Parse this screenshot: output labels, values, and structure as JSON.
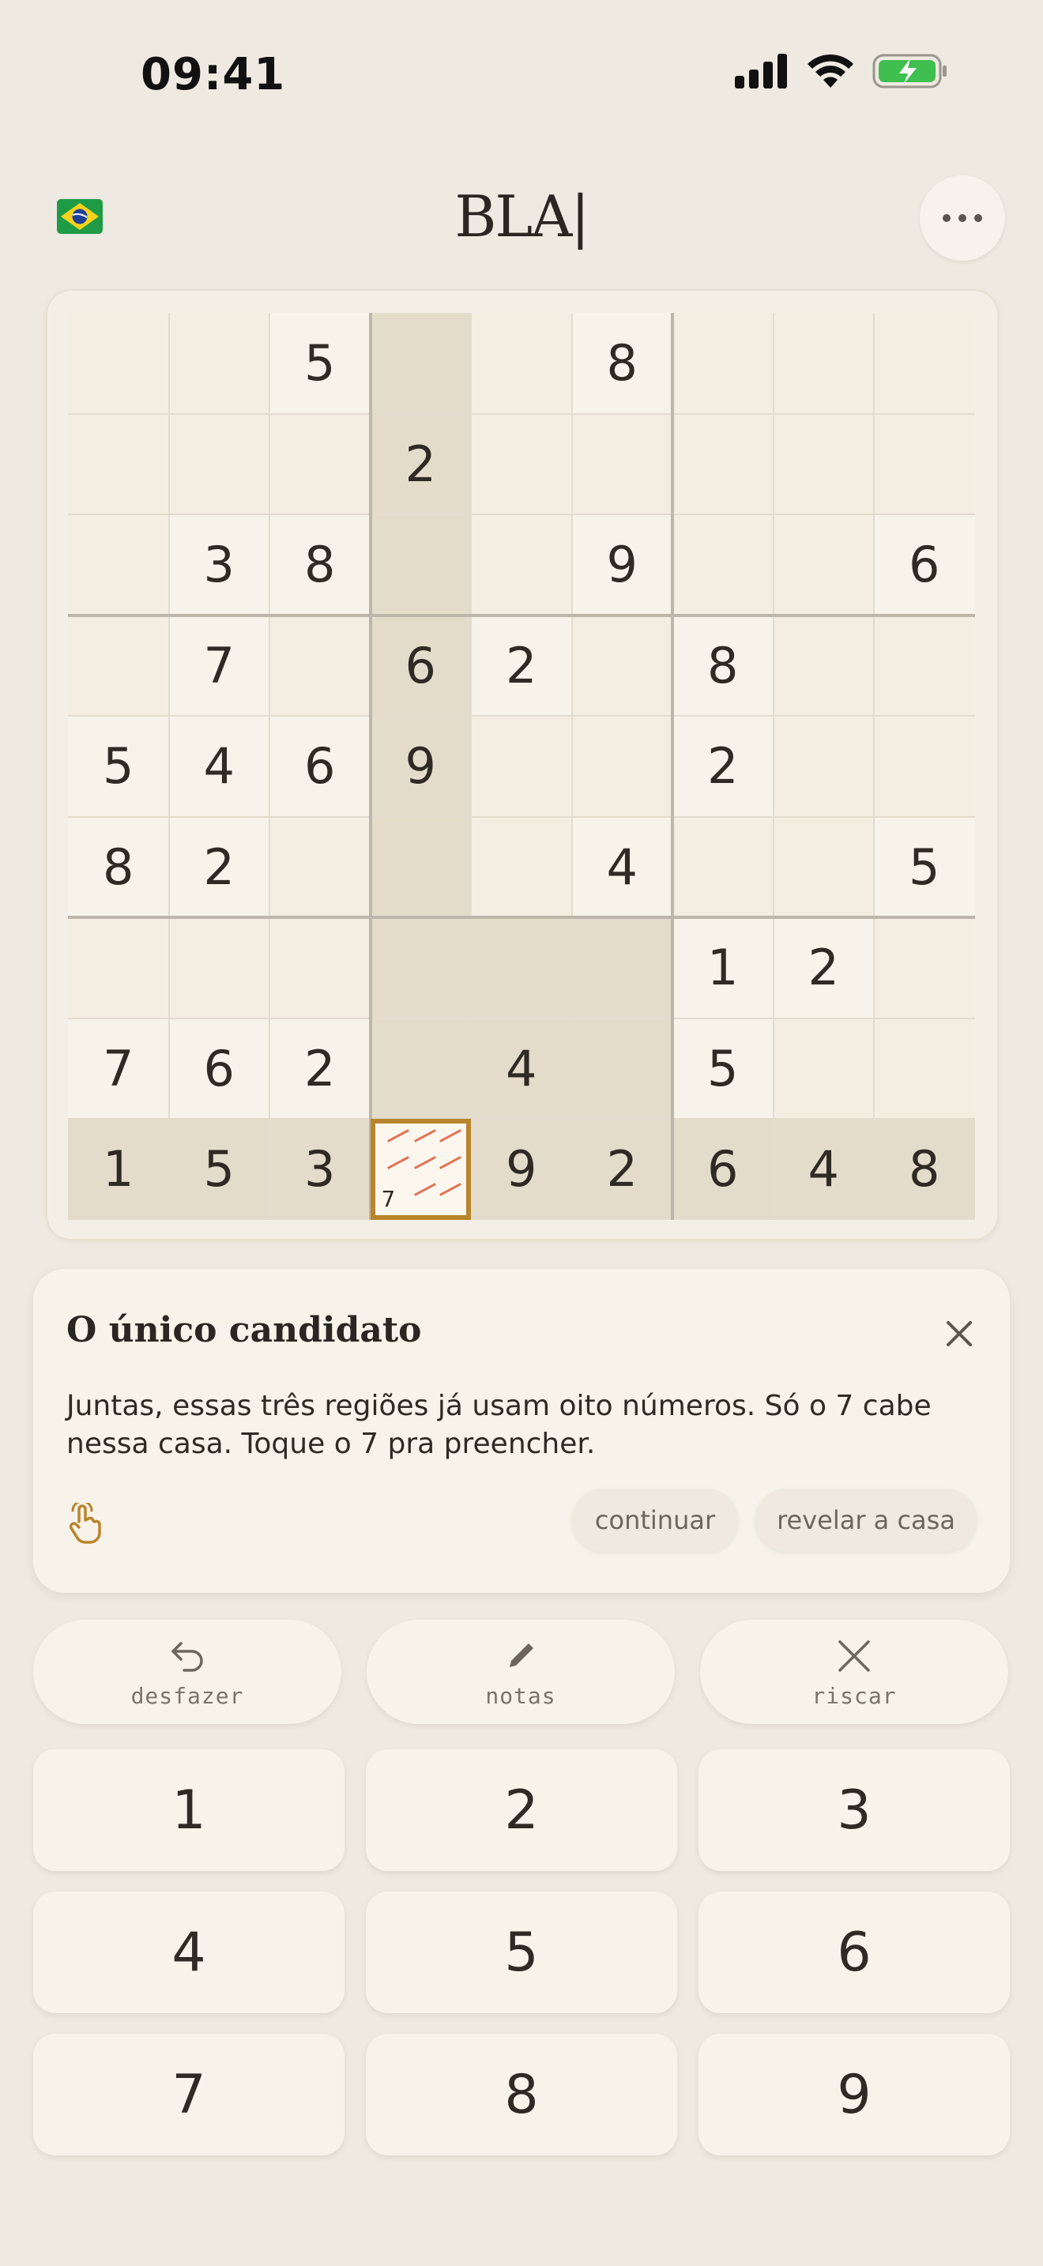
{
  "status_bar": {
    "time": "09:41"
  },
  "header": {
    "logo": "BLA|"
  },
  "board": {
    "cells": [
      [
        "",
        "",
        "5",
        "",
        "",
        "8",
        "",
        "",
        ""
      ],
      [
        "",
        "",
        "",
        "2",
        "",
        "",
        "",
        "",
        ""
      ],
      [
        "",
        "3",
        "8",
        "",
        "",
        "9",
        "",
        "",
        "6"
      ],
      [
        "",
        "7",
        "",
        "6",
        "2",
        "",
        "8",
        "",
        ""
      ],
      [
        "5",
        "4",
        "6",
        "9",
        "",
        "",
        "2",
        "",
        ""
      ],
      [
        "8",
        "2",
        "",
        "",
        "",
        "4",
        "",
        "",
        "5"
      ],
      [
        "",
        "",
        "",
        "",
        "",
        "",
        "1",
        "2",
        ""
      ],
      [
        "7",
        "6",
        "2",
        "",
        "4",
        "",
        "5",
        "",
        ""
      ],
      [
        "1",
        "5",
        "3",
        "",
        "9",
        "2",
        "6",
        "4",
        "8"
      ]
    ],
    "selected_note": "7"
  },
  "hint": {
    "title": "O único candidato",
    "body": "Juntas, essas três regiões já usam oito números. Só o 7 cabe nessa casa. Toque o 7 pra preencher.",
    "continue_label": "continuar",
    "reveal_label": "revelar a casa"
  },
  "tools": {
    "undo_label": "desfazer",
    "notes_label": "notas",
    "strike_label": "riscar"
  },
  "keypad": {
    "keys": [
      "1",
      "2",
      "3",
      "4",
      "5",
      "6",
      "7",
      "8",
      "9"
    ]
  },
  "colors": {
    "accent": "#b8842c",
    "background": "#efeae1",
    "highlight": "#e4dccb",
    "strike": "#e07355"
  }
}
